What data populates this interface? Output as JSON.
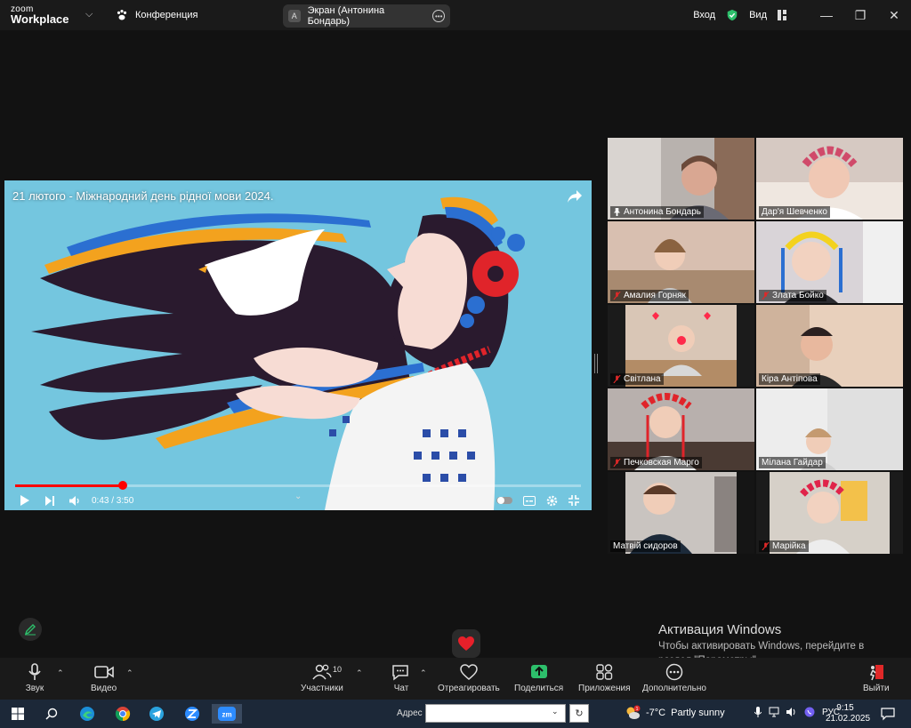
{
  "titlebar": {
    "logo_top": "zoom",
    "logo_bottom": "Workplace",
    "meeting_label": "Конференция",
    "screen_share_initial": "A",
    "screen_share_label": "Экран (Антонина Бондарь)",
    "signin": "Вход",
    "view": "Вид"
  },
  "video": {
    "title": "21 лютого - Міжнародний день рідної мови 2024.",
    "time": "0:43 / 3:50",
    "progress": 0.19
  },
  "participants": [
    {
      "name": "Антонина Бондарь",
      "pinned": true,
      "muted": false
    },
    {
      "name": "Дар'я Шевченко",
      "pinned": false,
      "muted": false
    },
    {
      "name": "Амалия Горняк",
      "pinned": false,
      "muted": true
    },
    {
      "name": "Злата Бойко",
      "pinned": false,
      "muted": true
    },
    {
      "name": "Світлана",
      "pinned": false,
      "muted": true
    },
    {
      "name": "Кіра Антіпова",
      "pinned": false,
      "muted": false
    },
    {
      "name": "Печковская Марго",
      "pinned": false,
      "muted": true
    },
    {
      "name": "Мілана Гайдар",
      "pinned": false,
      "muted": false
    },
    {
      "name": "Матвій сидоров",
      "pinned": false,
      "muted": false
    },
    {
      "name": "Марійка",
      "pinned": false,
      "muted": true
    }
  ],
  "watermark": {
    "title": "Активация Windows",
    "body": "Чтобы активировать Windows, перейдите в раздел \"Параметры\"."
  },
  "toolbar": {
    "audio": "Звук",
    "video": "Видео",
    "participants": "Участники",
    "participants_count": "10",
    "chat": "Чат",
    "react": "Отреагировать",
    "share": "Поделиться",
    "apps": "Приложения",
    "more": "Дополнительно",
    "leave": "Выйти"
  },
  "taskbar": {
    "address_label": "Адрес",
    "address_value": "",
    "weather_temp": "-7°C",
    "weather_text": "Partly sunny",
    "lang": "РУС",
    "time": "9:15",
    "date": "21.02.2025",
    "weather_badge": "1"
  },
  "colors": {
    "accent_green": "#2dbf6b",
    "progress_red": "#ff0000",
    "leave_red": "#e02828"
  }
}
